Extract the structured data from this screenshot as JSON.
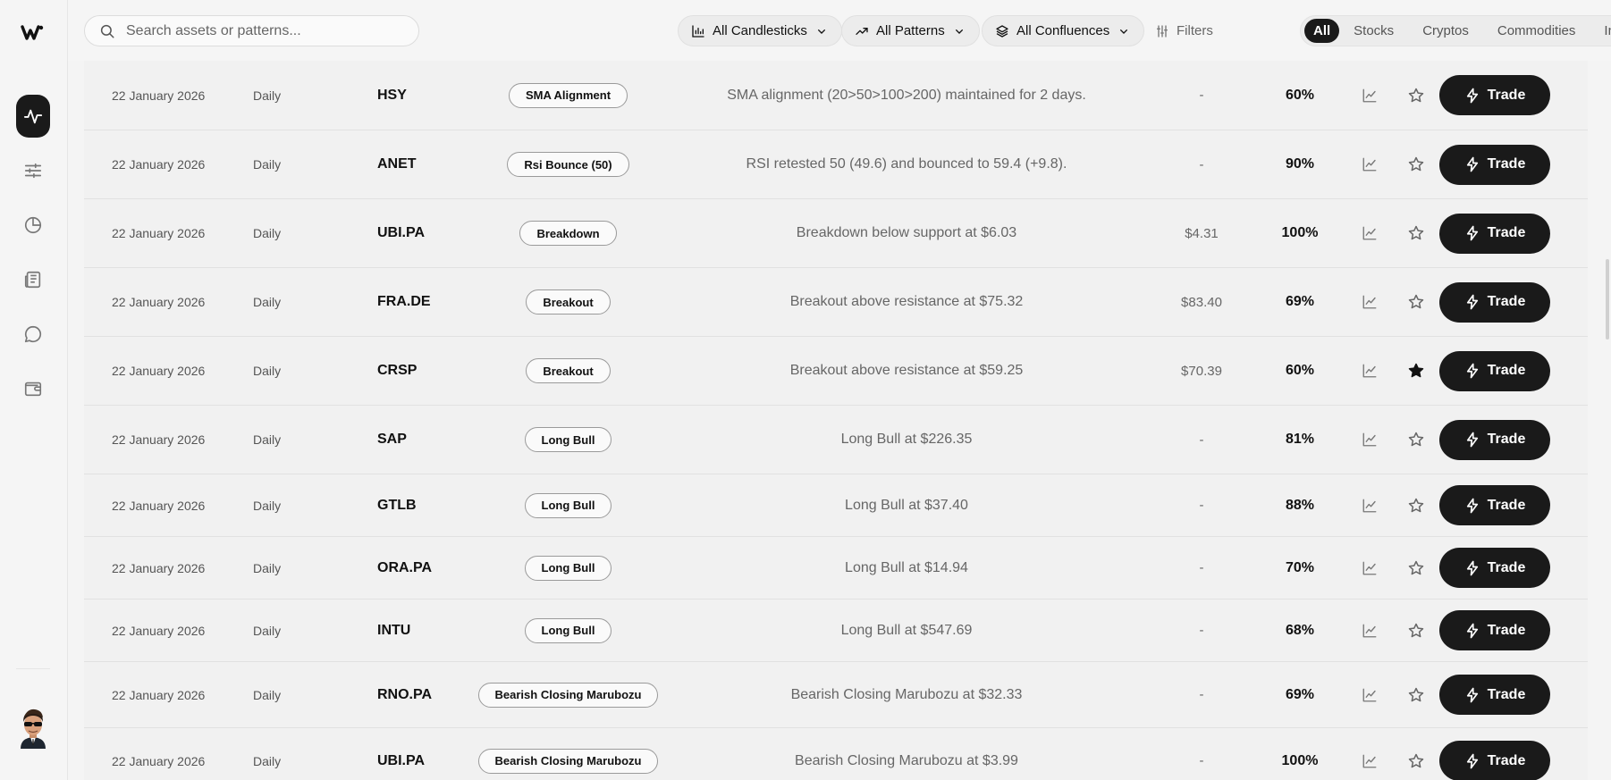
{
  "search": {
    "placeholder": "Search assets or patterns..."
  },
  "filters": {
    "candlesticks": "All Candlesticks",
    "patterns": "All Patterns",
    "confluences": "All Confluences",
    "filters_label": "Filters"
  },
  "asset_tabs": [
    "All",
    "Stocks",
    "Cryptos",
    "Commodities",
    "Index"
  ],
  "active_tab": "All",
  "trade_label": "Trade",
  "rows": [
    {
      "date": "22 January 2026",
      "frequency": "Daily",
      "symbol": "HSY",
      "pattern": "SMA Alignment",
      "description": "SMA alignment (20>50>100>200) maintained for 2 days.",
      "target": "-",
      "confidence": "60%",
      "starred": false
    },
    {
      "date": "22 January 2026",
      "frequency": "Daily",
      "symbol": "ANET",
      "pattern": "Rsi Bounce (50)",
      "description": "RSI retested 50 (49.6) and bounced to 59.4 (+9.8).",
      "target": "-",
      "confidence": "90%",
      "starred": false
    },
    {
      "date": "22 January 2026",
      "frequency": "Daily",
      "symbol": "UBI.PA",
      "pattern": "Breakdown",
      "description": "Breakdown below support at $6.03",
      "target": "$4.31",
      "confidence": "100%",
      "starred": false
    },
    {
      "date": "22 January 2026",
      "frequency": "Daily",
      "symbol": "FRA.DE",
      "pattern": "Breakout",
      "description": "Breakout above resistance at $75.32",
      "target": "$83.40",
      "confidence": "69%",
      "starred": false
    },
    {
      "date": "22 January 2026",
      "frequency": "Daily",
      "symbol": "CRSP",
      "pattern": "Breakout",
      "description": "Breakout above resistance at $59.25",
      "target": "$70.39",
      "confidence": "60%",
      "starred": true
    },
    {
      "date": "22 January 2026",
      "frequency": "Daily",
      "symbol": "SAP",
      "pattern": "Long Bull",
      "description": "Long Bull at $226.35",
      "target": "-",
      "confidence": "81%",
      "starred": false
    },
    {
      "date": "22 January 2026",
      "frequency": "Daily",
      "symbol": "GTLB",
      "pattern": "Long Bull",
      "description": "Long Bull at $37.40",
      "target": "-",
      "confidence": "88%",
      "starred": false
    },
    {
      "date": "22 January 2026",
      "frequency": "Daily",
      "symbol": "ORA.PA",
      "pattern": "Long Bull",
      "description": "Long Bull at $14.94",
      "target": "-",
      "confidence": "70%",
      "starred": false
    },
    {
      "date": "22 January 2026",
      "frequency": "Daily",
      "symbol": "INTU",
      "pattern": "Long Bull",
      "description": "Long Bull at $547.69",
      "target": "-",
      "confidence": "68%",
      "starred": false
    },
    {
      "date": "22 January 2026",
      "frequency": "Daily",
      "symbol": "RNO.PA",
      "pattern": "Bearish Closing Marubozu",
      "description": "Bearish Closing Marubozu at $32.33",
      "target": "-",
      "confidence": "69%",
      "starred": false
    },
    {
      "date": "22 January 2026",
      "frequency": "Daily",
      "symbol": "UBI.PA",
      "pattern": "Bearish Closing Marubozu",
      "description": "Bearish Closing Marubozu at $3.99",
      "target": "-",
      "confidence": "100%",
      "starred": false
    }
  ],
  "sidebar": {
    "items": [
      {
        "icon": "pulse-icon",
        "active": true
      },
      {
        "icon": "sliders-icon",
        "active": false
      },
      {
        "icon": "pie-chart-icon",
        "active": false
      },
      {
        "icon": "news-icon",
        "active": false
      },
      {
        "icon": "chat-icon",
        "active": false
      },
      {
        "icon": "wallet-icon",
        "active": false
      }
    ]
  },
  "colors": {
    "accent": "#1a1a1a",
    "background": "#f4f4f4"
  }
}
